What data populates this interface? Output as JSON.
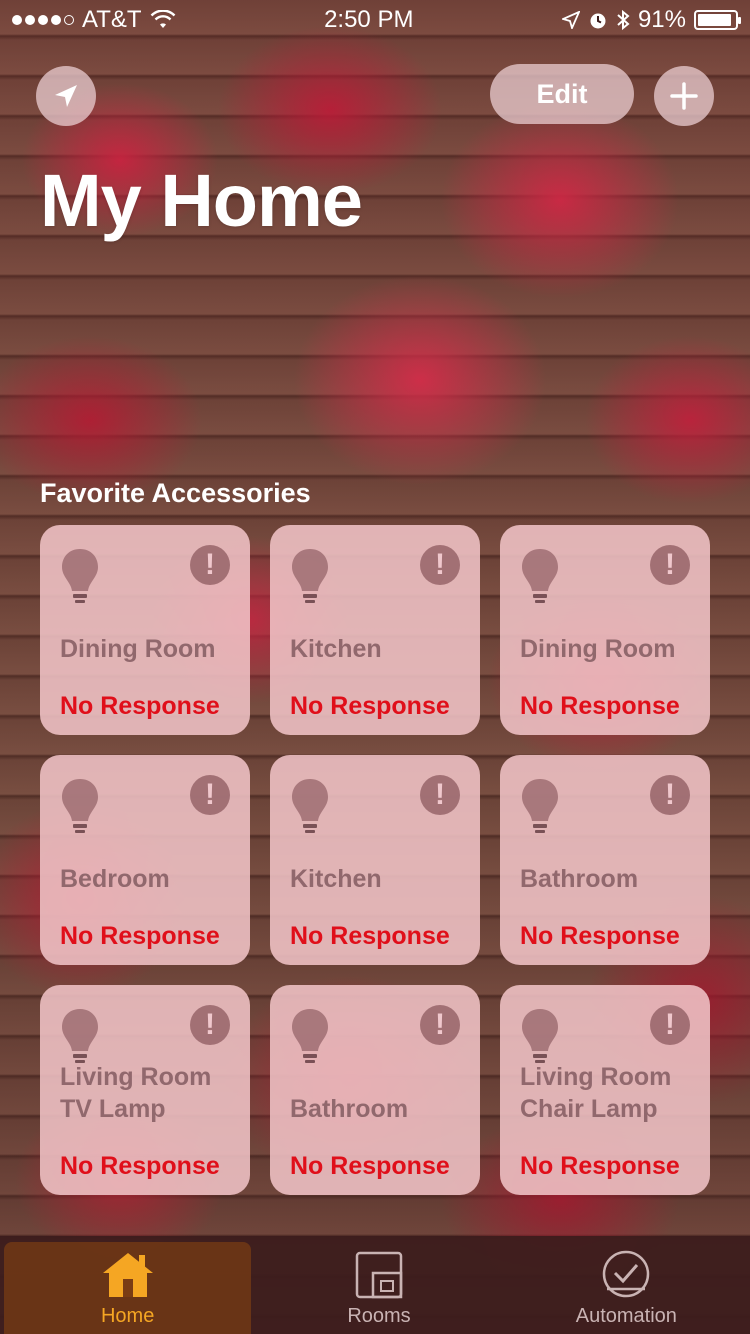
{
  "status_bar": {
    "carrier": "AT&T",
    "time": "2:50 PM",
    "battery_percent": "91%",
    "battery_level": 0.91,
    "signal_bars_filled": 4,
    "signal_bars_total": 5
  },
  "header": {
    "location_icon": "location-arrow-icon",
    "edit_label": "Edit",
    "add_icon": "plus-icon",
    "title": "My Home"
  },
  "favorites": {
    "section_title": "Favorite Accessories",
    "tiles": [
      {
        "name": "Dining Room",
        "status": "No Response"
      },
      {
        "name": "Kitchen",
        "status": "No Response"
      },
      {
        "name": "Dining Room",
        "status": "No Response"
      },
      {
        "name": "Bedroom",
        "status": "No Response"
      },
      {
        "name": "Kitchen",
        "status": "No Response"
      },
      {
        "name": "Bathroom",
        "status": "No Response"
      },
      {
        "name": "Living Room\nTV Lamp",
        "status": "No Response"
      },
      {
        "name": "Bathroom",
        "status": "No Response"
      },
      {
        "name": "Living Room\nChair Lamp",
        "status": "No Response"
      }
    ]
  },
  "tabbar": {
    "tabs": [
      {
        "label": "Home",
        "icon": "house-icon",
        "active": true
      },
      {
        "label": "Rooms",
        "icon": "rooms-icon",
        "active": false
      },
      {
        "label": "Automation",
        "icon": "clock-check-icon",
        "active": false
      }
    ]
  },
  "colors": {
    "accent_active_tab": "#f5a623",
    "no_response": "#e00f1a"
  }
}
